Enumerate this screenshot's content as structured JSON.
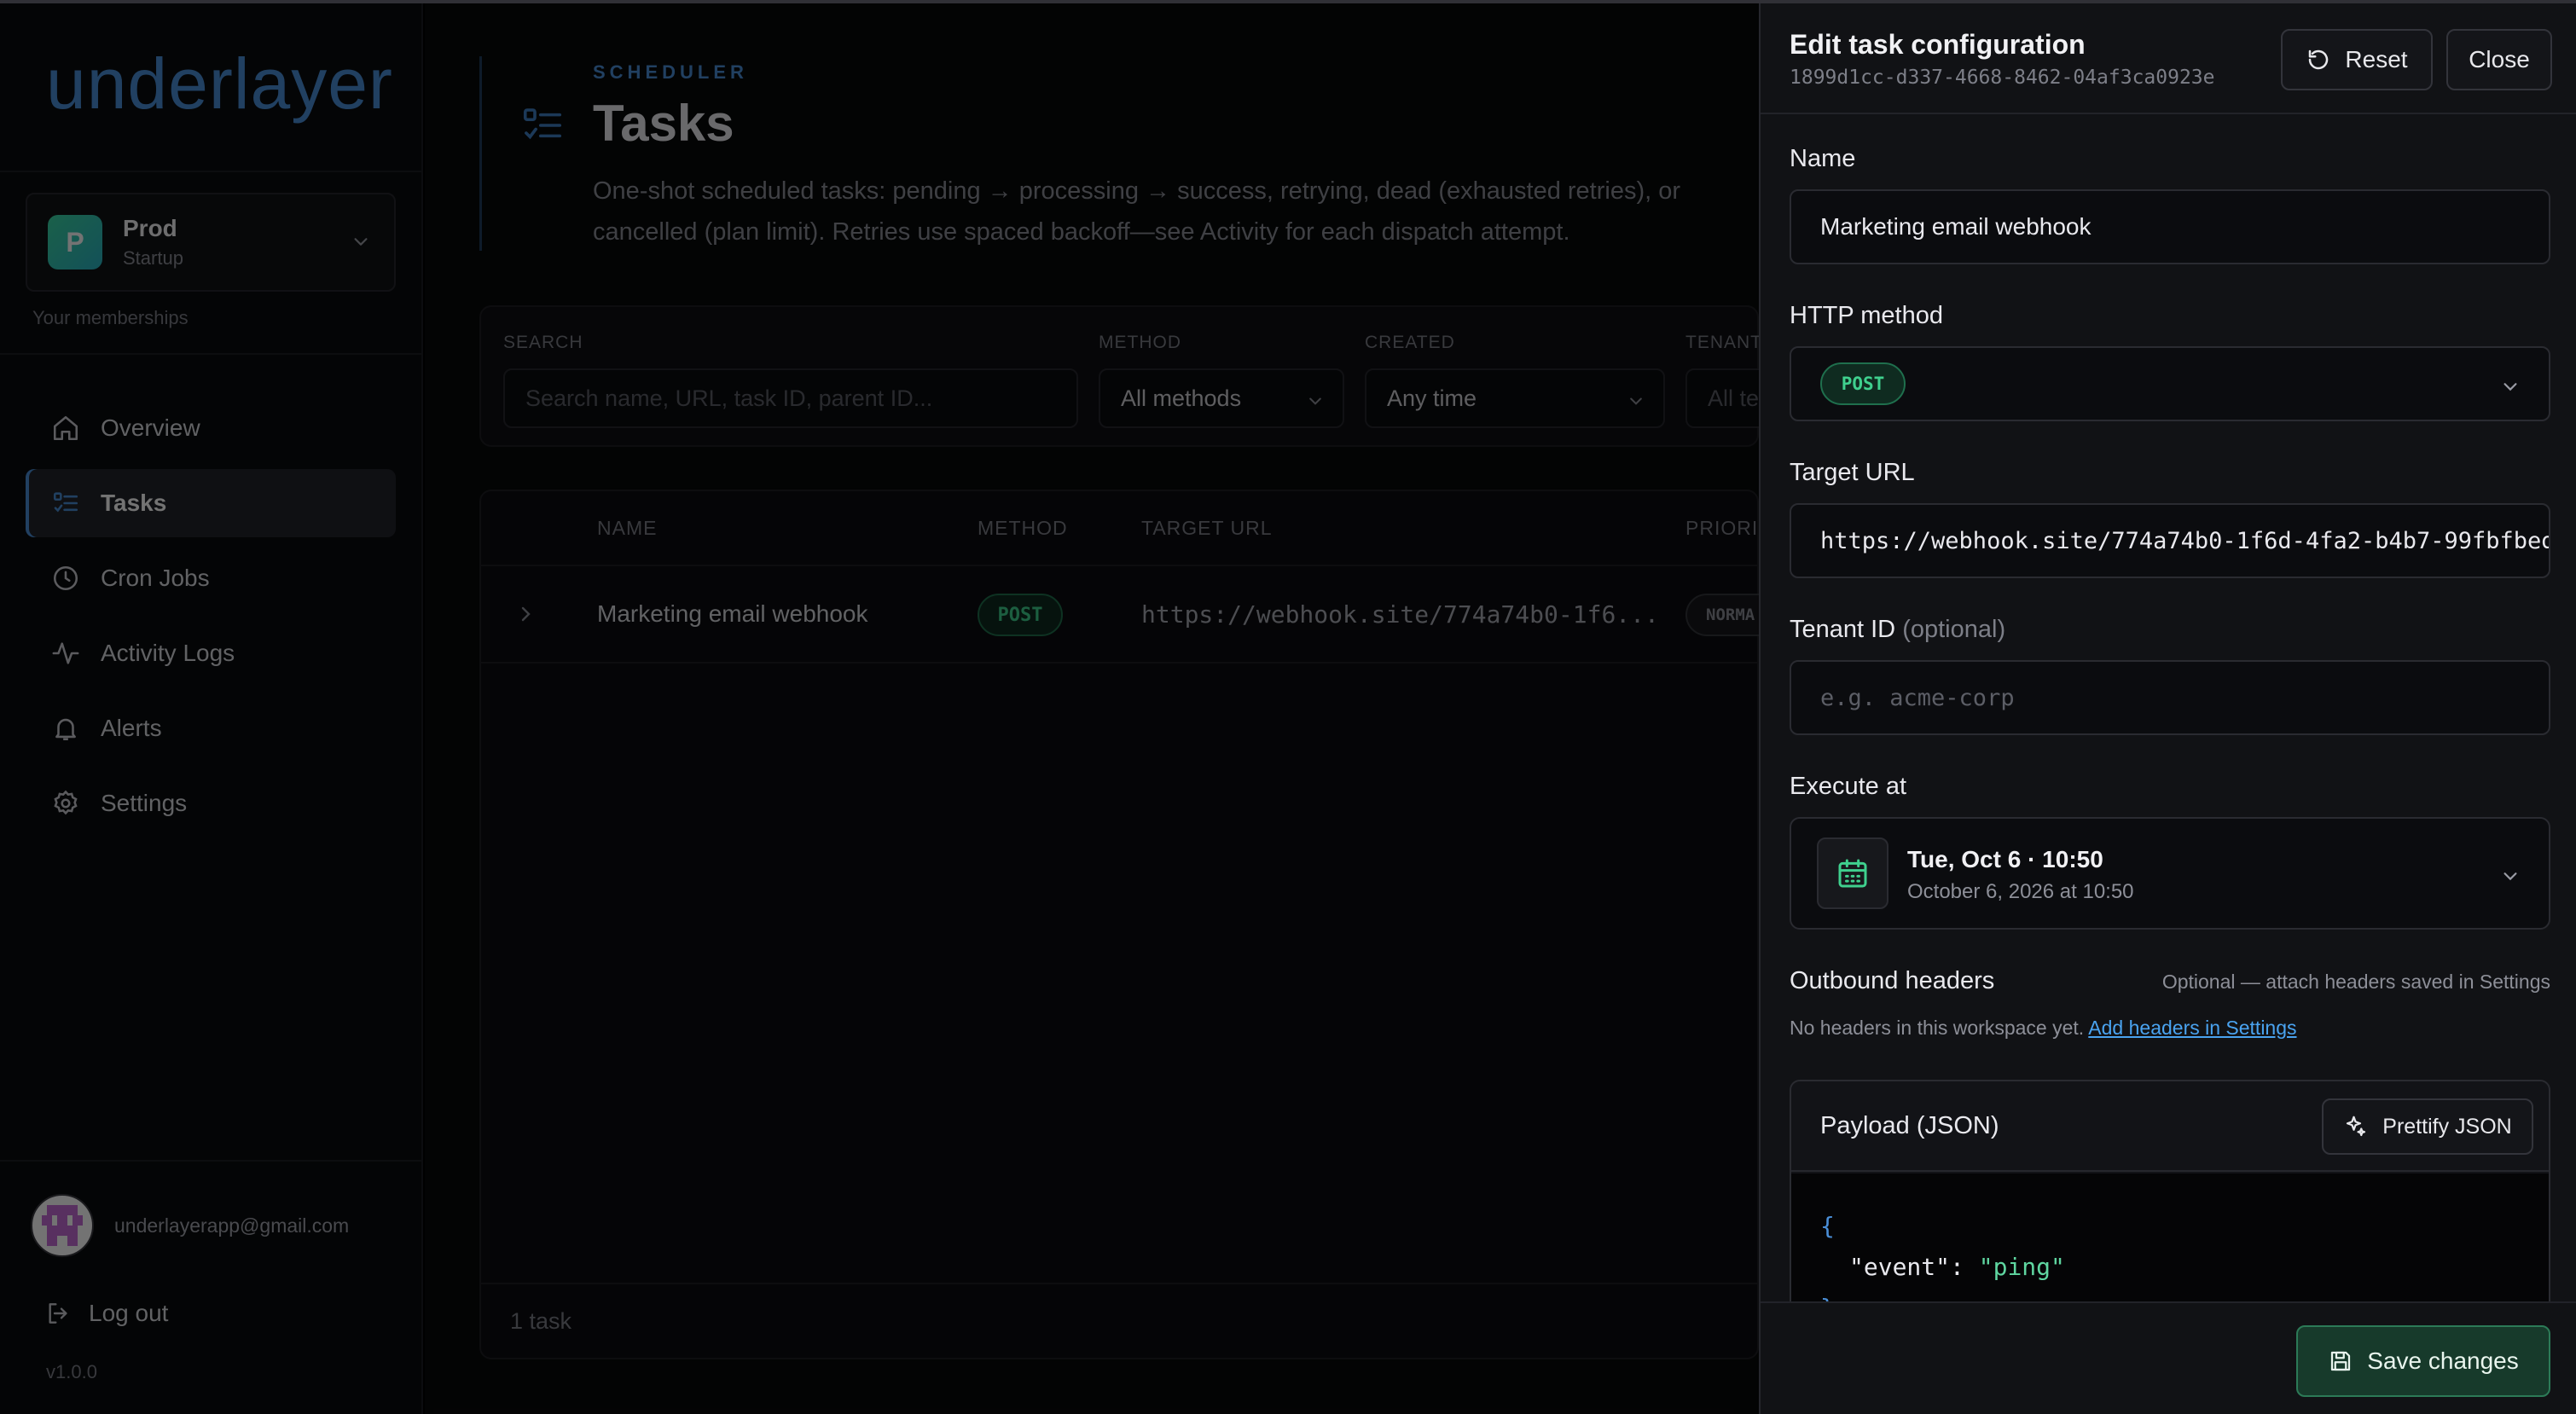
{
  "app": {
    "logo": "underlayer",
    "version": "v1.0.0"
  },
  "workspace": {
    "initial": "P",
    "name": "Prod",
    "plan": "Startup",
    "memberships_label": "Your memberships"
  },
  "nav": {
    "items": [
      {
        "label": "Overview",
        "icon": "home-icon"
      },
      {
        "label": "Tasks",
        "icon": "tasks-list-icon",
        "active": true
      },
      {
        "label": "Cron Jobs",
        "icon": "clock-icon"
      },
      {
        "label": "Activity Logs",
        "icon": "activity-icon"
      },
      {
        "label": "Alerts",
        "icon": "bell-icon"
      },
      {
        "label": "Settings",
        "icon": "gear-icon"
      }
    ]
  },
  "user": {
    "email": "underlayerapp@gmail.com",
    "logout_label": "Log out"
  },
  "page": {
    "eyebrow": "SCHEDULER",
    "title": "Tasks",
    "description": "One-shot scheduled tasks: pending → processing → success, retrying, dead (exhausted retries), or cancelled (plan limit). Retries use spaced backoff—see Activity for each dispatch attempt."
  },
  "filters": {
    "search_label": "SEARCH",
    "search_placeholder": "Search name, URL, task ID, parent ID...",
    "method_label": "METHOD",
    "method_value": "All methods",
    "created_label": "CREATED",
    "created_value": "Any time",
    "tenant_label": "TENANT",
    "tenant_value": "All te"
  },
  "table": {
    "columns": [
      "NAME",
      "METHOD",
      "TARGET URL",
      "PRIORI"
    ],
    "rows": [
      {
        "name": "Marketing email webhook",
        "method": "POST",
        "url": "https://webhook.site/774a74b0-1f6...",
        "priority": "NORMA"
      }
    ],
    "footer": "1 task"
  },
  "drawer": {
    "title": "Edit task configuration",
    "task_id": "1899d1cc-d337-4668-8462-04af3ca0923e",
    "reset_label": "Reset",
    "close_label": "Close",
    "name_label": "Name",
    "name_value": "Marketing email webhook",
    "method_label": "HTTP method",
    "method_value": "POST",
    "url_label": "Target URL",
    "url_value": "https://webhook.site/774a74b0-1f6d-4fa2-b4b7-99fbfbed",
    "tenant_label": "Tenant ID",
    "tenant_optional": "(optional)",
    "tenant_placeholder": "e.g. acme-corp",
    "execute_label": "Execute at",
    "execute_main": "Tue, Oct 6 · 10:50",
    "execute_sub": "October 6, 2026 at 10:50",
    "headers_label": "Outbound headers",
    "headers_hint": "Optional — attach headers saved in Settings",
    "headers_none": "No headers in this workspace yet.",
    "headers_link": "Add headers in Settings",
    "payload_label": "Payload (JSON)",
    "prettify_label": "Prettify JSON",
    "payload_open": "{",
    "payload_key": "\"event\"",
    "payload_colon": ": ",
    "payload_value": "\"ping\"",
    "payload_close": "}",
    "save_label": "Save changes"
  },
  "colors": {
    "accent": "#4a8fd8",
    "success": "#3fd08e",
    "link": "#4aa3f0"
  }
}
